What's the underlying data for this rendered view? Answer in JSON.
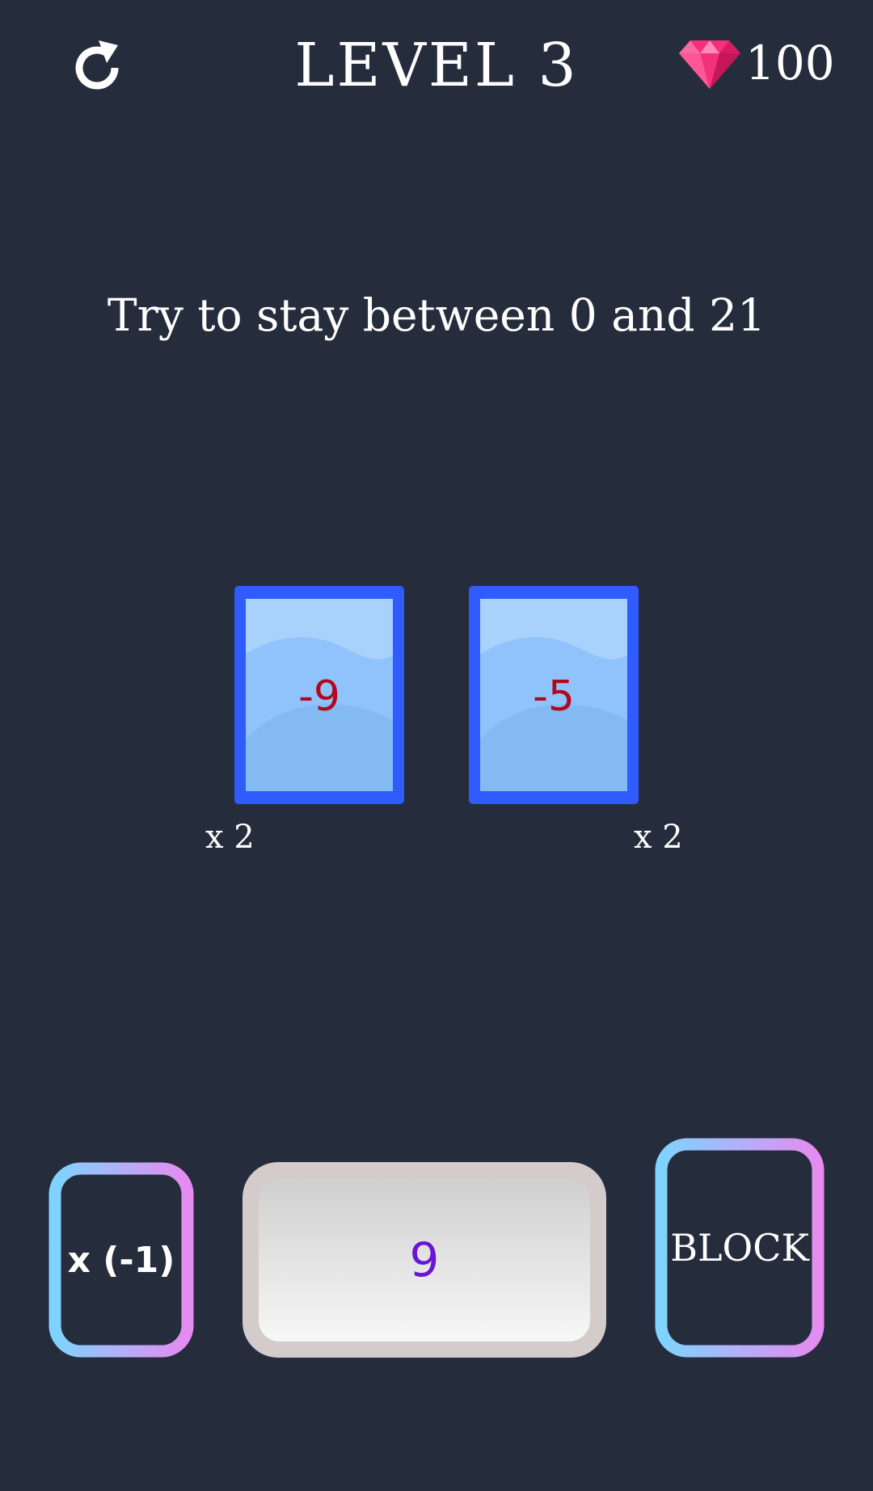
{
  "header": {
    "level_title": "LEVEL 3",
    "gems": "100",
    "restart_icon": "restart-icon",
    "gem_icon": "gem-icon",
    "gem_color": "#f2317a"
  },
  "instruction": "Try to stay between 0 and 21",
  "cards": [
    {
      "value": "-9",
      "multiplier": "x 2"
    },
    {
      "value": "-5",
      "multiplier": "x 2"
    }
  ],
  "controls": {
    "negate_label": "x (-1)",
    "current_value": "9",
    "block_label": "BLOCK",
    "gradient_start": "#7fd3ff",
    "gradient_end": "#e68bf0"
  },
  "colors": {
    "background": "#252d3c",
    "card_border": "#2f5bff",
    "card_value": "#b3081b",
    "display_value": "#6b13d6"
  }
}
